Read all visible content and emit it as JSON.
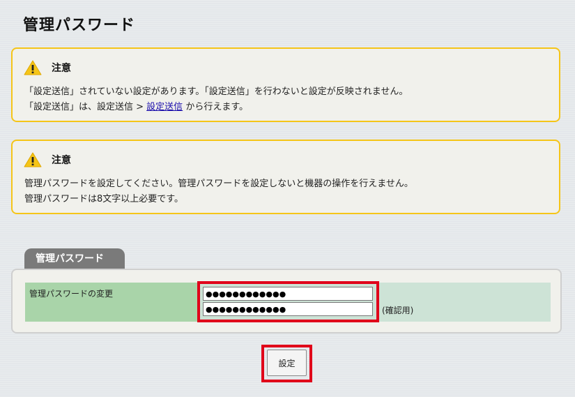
{
  "page": {
    "title": "管理パスワード"
  },
  "notices": [
    {
      "title": "注意",
      "icon": "warning-icon",
      "line1": "「設定送信」されていない設定があります。「設定送信」を行わないと設定が反映されません。",
      "line2_pre": "「設定送信」は、設定送信 > ",
      "line2_link": "設定送信",
      "line2_post": " から行えます。"
    },
    {
      "title": "注意",
      "icon": "warning-icon",
      "line1": "管理パスワードを設定してください。管理パスワードを設定しないと機器の操作を行えません。",
      "line2": "管理パスワードは8文字以上必要です。"
    }
  ],
  "section": {
    "tab_label": "管理パスワード",
    "row_label": "管理パスワードの変更",
    "password_value": "●●●●●●●●●●●●",
    "confirm_value": "●●●●●●●●●●●●",
    "confirm_note": "(確認用)"
  },
  "actions": {
    "set_label": "設定"
  },
  "colors": {
    "notice_border": "#f5c518",
    "highlight": "#e0001a",
    "tab_bg": "#7a7a7a",
    "label_bg": "#a9d4a9",
    "row_bg": "#cde3d6"
  }
}
